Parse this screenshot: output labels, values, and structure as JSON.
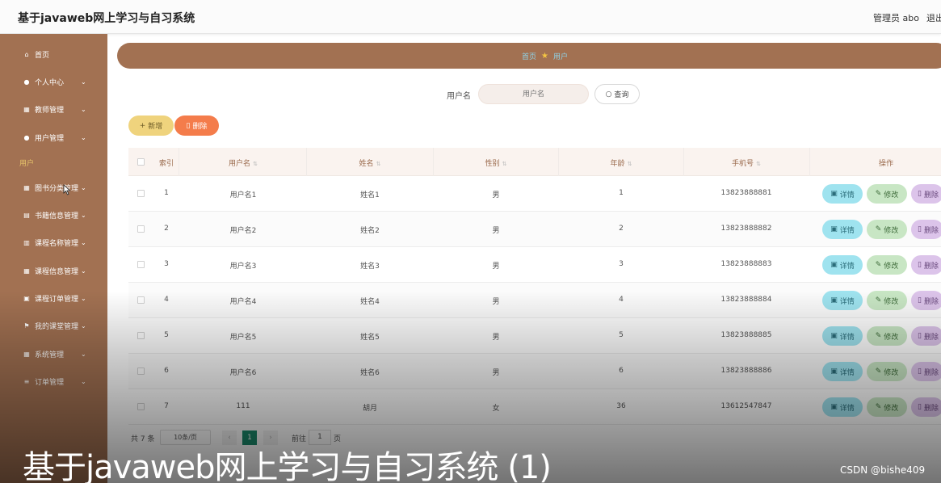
{
  "app": {
    "title": "基于javaweb网上学习与自习系统",
    "admin": "管理员 abo",
    "logout": "退出"
  },
  "sidebar": {
    "items": [
      {
        "label": "首页",
        "icon": "home-icon",
        "glyph": "⌂",
        "has_chevron": false
      },
      {
        "label": "个人中心",
        "icon": "user-icon",
        "glyph": "●",
        "has_chevron": true
      },
      {
        "label": "教师管理",
        "icon": "grid-icon",
        "glyph": "▦",
        "has_chevron": true
      },
      {
        "label": "用户管理",
        "icon": "user-icon",
        "glyph": "●",
        "has_chevron": true
      },
      {
        "label": "图书分类管理",
        "icon": "grid-icon",
        "glyph": "▦",
        "has_chevron": true
      },
      {
        "label": "书籍信息管理",
        "icon": "book-icon",
        "glyph": "▤",
        "has_chevron": true
      },
      {
        "label": "课程名称管理",
        "icon": "list-icon",
        "glyph": "▥",
        "has_chevron": true
      },
      {
        "label": "课程信息管理",
        "icon": "grid-icon",
        "glyph": "▦",
        "has_chevron": true
      },
      {
        "label": "课程订单管理",
        "icon": "cart-icon",
        "glyph": "▣",
        "has_chevron": true
      },
      {
        "label": "我的课堂管理",
        "icon": "flag-icon",
        "glyph": "⚑",
        "has_chevron": true
      },
      {
        "label": "系统管理",
        "icon": "grid-icon",
        "glyph": "▦",
        "has_chevron": true
      },
      {
        "label": "订单管理",
        "icon": "menu-icon",
        "glyph": "≡",
        "has_chevron": true
      }
    ],
    "sub_active": "用户"
  },
  "breadcrumb": {
    "home": "首页",
    "current": "用户"
  },
  "search": {
    "label": "用户名",
    "placeholder": "用户名",
    "button": "查询"
  },
  "actions": {
    "add": "新增",
    "delete": "删除"
  },
  "table": {
    "headers": [
      "索引",
      "用户名",
      "姓名",
      "性别",
      "年龄",
      "手机号",
      "操作"
    ],
    "rows": [
      {
        "idx": "1",
        "username": "用户名1",
        "name": "姓名1",
        "gender": "男",
        "age": "1",
        "phone": "13823888881"
      },
      {
        "idx": "2",
        "username": "用户名2",
        "name": "姓名2",
        "gender": "男",
        "age": "2",
        "phone": "13823888882"
      },
      {
        "idx": "3",
        "username": "用户名3",
        "name": "姓名3",
        "gender": "男",
        "age": "3",
        "phone": "13823888883"
      },
      {
        "idx": "4",
        "username": "用户名4",
        "name": "姓名4",
        "gender": "男",
        "age": "4",
        "phone": "13823888884"
      },
      {
        "idx": "5",
        "username": "用户名5",
        "name": "姓名5",
        "gender": "男",
        "age": "5",
        "phone": "13823888885"
      },
      {
        "idx": "6",
        "username": "用户名6",
        "name": "姓名6",
        "gender": "男",
        "age": "6",
        "phone": "13823888886"
      },
      {
        "idx": "7",
        "username": "111",
        "name": "胡月",
        "gender": "女",
        "age": "36",
        "phone": "13612547847"
      }
    ],
    "op_labels": {
      "detail": "详情",
      "edit": "修改",
      "remove": "删除"
    }
  },
  "pager": {
    "total": "共 7 条",
    "page_size": "10条/页",
    "current_page": "1",
    "goto_label": "前往",
    "goto_value": "1",
    "page_unit": "页"
  },
  "caption": "基于javaweb网上学习与自习系统 (1)",
  "watermark": "CSDN @bishe409",
  "colors": {
    "sidebar": "#a27152",
    "accent_gold": "#e6c36a",
    "page_active": "#1b8a6b",
    "add_button": "#efd37d",
    "delete_button": "#f47c4b"
  }
}
